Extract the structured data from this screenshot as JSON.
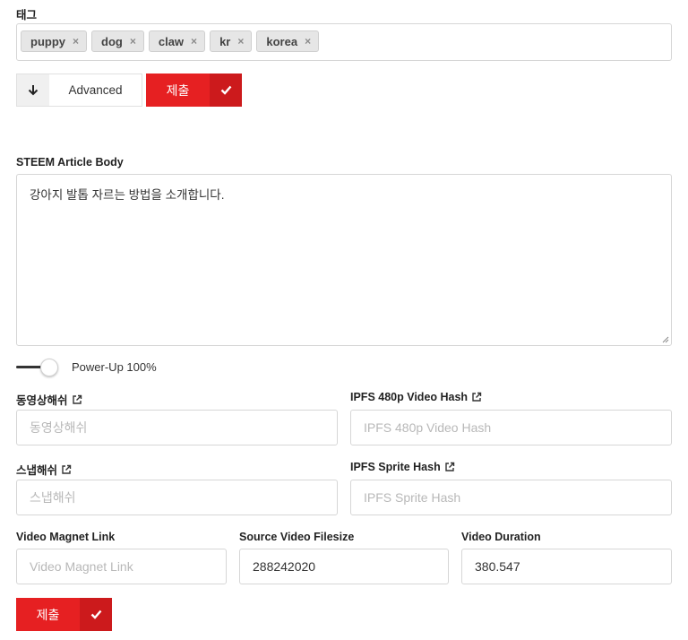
{
  "tags": {
    "label": "태그",
    "items": [
      "puppy",
      "dog",
      "claw",
      "kr",
      "korea"
    ],
    "remove_glyph": "×"
  },
  "advanced": {
    "label": "Advanced"
  },
  "submit": {
    "label": "제출"
  },
  "article_body": {
    "label": "STEEM Article Body",
    "value": "강아지 발톱 자르는 방법을 소개합니다."
  },
  "power_up": {
    "label": "Power-Up 100%",
    "enabled": true
  },
  "video_hash": {
    "label": "동영상해쉬",
    "placeholder": "동영상해쉬",
    "value": ""
  },
  "ipfs_480p": {
    "label": "IPFS 480p Video Hash",
    "placeholder": "IPFS 480p Video Hash",
    "value": ""
  },
  "snap_hash": {
    "label": "스냅해쉬",
    "placeholder": "스냅해쉬",
    "value": ""
  },
  "ipfs_sprite": {
    "label": "IPFS Sprite Hash",
    "placeholder": "IPFS Sprite Hash",
    "value": ""
  },
  "magnet_link": {
    "label": "Video Magnet Link",
    "placeholder": "Video Magnet Link",
    "value": ""
  },
  "filesize": {
    "label": "Source Video Filesize",
    "value": "288242020"
  },
  "duration": {
    "label": "Video Duration",
    "value": "380.547"
  },
  "colors": {
    "accent": "#e62022",
    "accent_dark": "#cc1a1c",
    "border": "#d6d6d6"
  }
}
